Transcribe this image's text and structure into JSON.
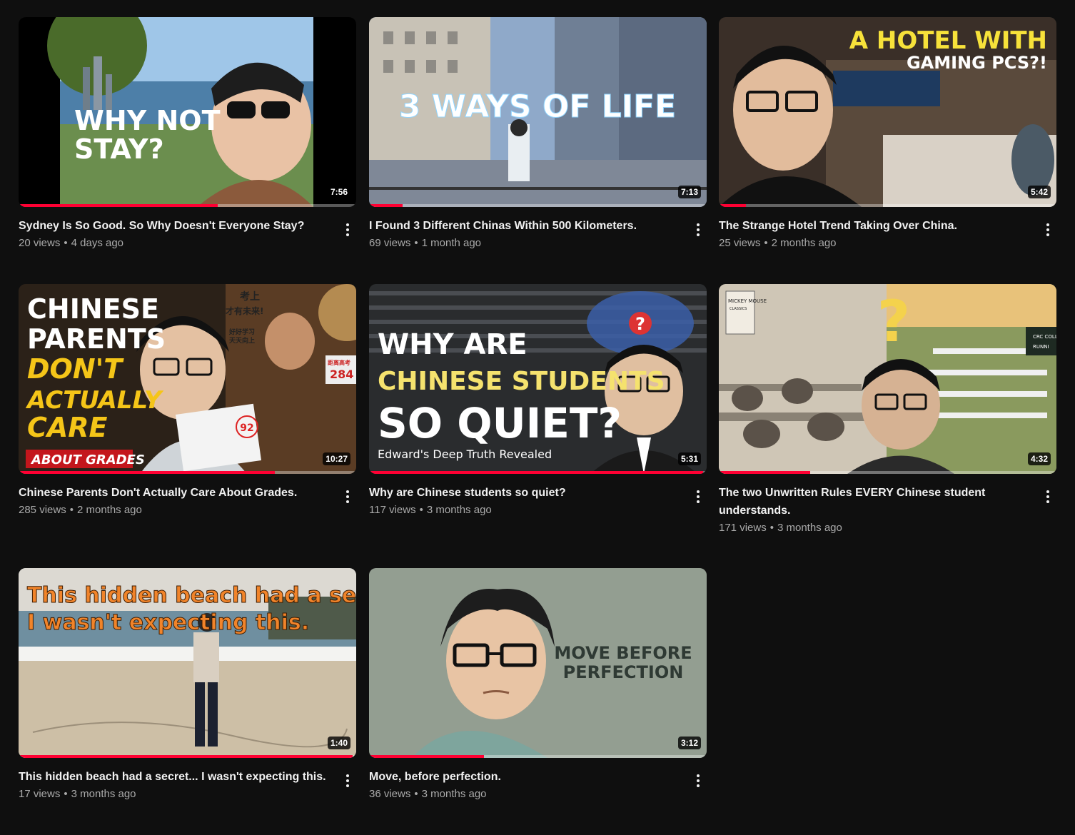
{
  "colors": {
    "background": "#0f0f0f",
    "progress": "#ff0033",
    "meta_text": "#aaaaaa"
  },
  "videos": [
    {
      "title": "Sydney Is So Good. So Why Doesn't Everyone Stay?",
      "views": "20 views",
      "age": "4 days ago",
      "duration": "7:56",
      "watched_fraction": 0.59,
      "thumb_text": [
        "WHY NOT",
        "STAY?"
      ]
    },
    {
      "title": "I Found 3 Different Chinas Within 500 Kilometers.",
      "views": "69 views",
      "age": "1 month ago",
      "duration": "7:13",
      "watched_fraction": 0.1,
      "thumb_text": [
        "3 WAYS OF LIFE"
      ]
    },
    {
      "title": "The Strange Hotel Trend Taking Over China.",
      "views": "25 views",
      "age": "2 months ago",
      "duration": "5:42",
      "watched_fraction": 0.08,
      "thumb_text": [
        "A HOTEL WITH",
        "GAMING PCS?!"
      ]
    },
    {
      "title": "Chinese Parents Don't Actually Care About Grades.",
      "views": "285 views",
      "age": "2 months ago",
      "duration": "10:27",
      "watched_fraction": 0.76,
      "thumb_text": [
        "CHINESE",
        "PARENTS",
        "DON'T",
        "ACTUALLY",
        "CARE",
        "ABOUT GRADES",
        "92",
        "考上",
        "才有未来!",
        "好好学习",
        "天天向上",
        "距离高考",
        "284"
      ]
    },
    {
      "title": "Why are Chinese students so quiet?",
      "views": "117 views",
      "age": "3 months ago",
      "duration": "5:31",
      "watched_fraction": 0.99,
      "thumb_text": [
        "WHY ARE",
        "CHINESE STUDENTS",
        "SO QUIET?",
        "Edward's Deep Truth Revealed"
      ]
    },
    {
      "title": "The two Unwritten Rules EVERY Chinese student understands.",
      "views": "171 views",
      "age": "3 months ago",
      "duration": "4:32",
      "watched_fraction": 0.27,
      "thumb_text": [
        "MICKEY MOUSE",
        "CLASSICS",
        "CRC COLL",
        "RUNNI"
      ]
    },
    {
      "title": "This hidden beach had a secret... I wasn't expecting this.",
      "views": "17 views",
      "age": "3 months ago",
      "duration": "1:40",
      "watched_fraction": 0.99,
      "thumb_text": [
        "This hidden beach had a secret...",
        "I wasn't expecting this."
      ]
    },
    {
      "title": "Move, before perfection.",
      "views": "36 views",
      "age": "3 months ago",
      "duration": "3:12",
      "watched_fraction": 0.34,
      "thumb_text": [
        "MOVE BEFORE",
        "PERFECTION"
      ]
    }
  ],
  "icons": {
    "menu": "more-vertical-icon"
  }
}
